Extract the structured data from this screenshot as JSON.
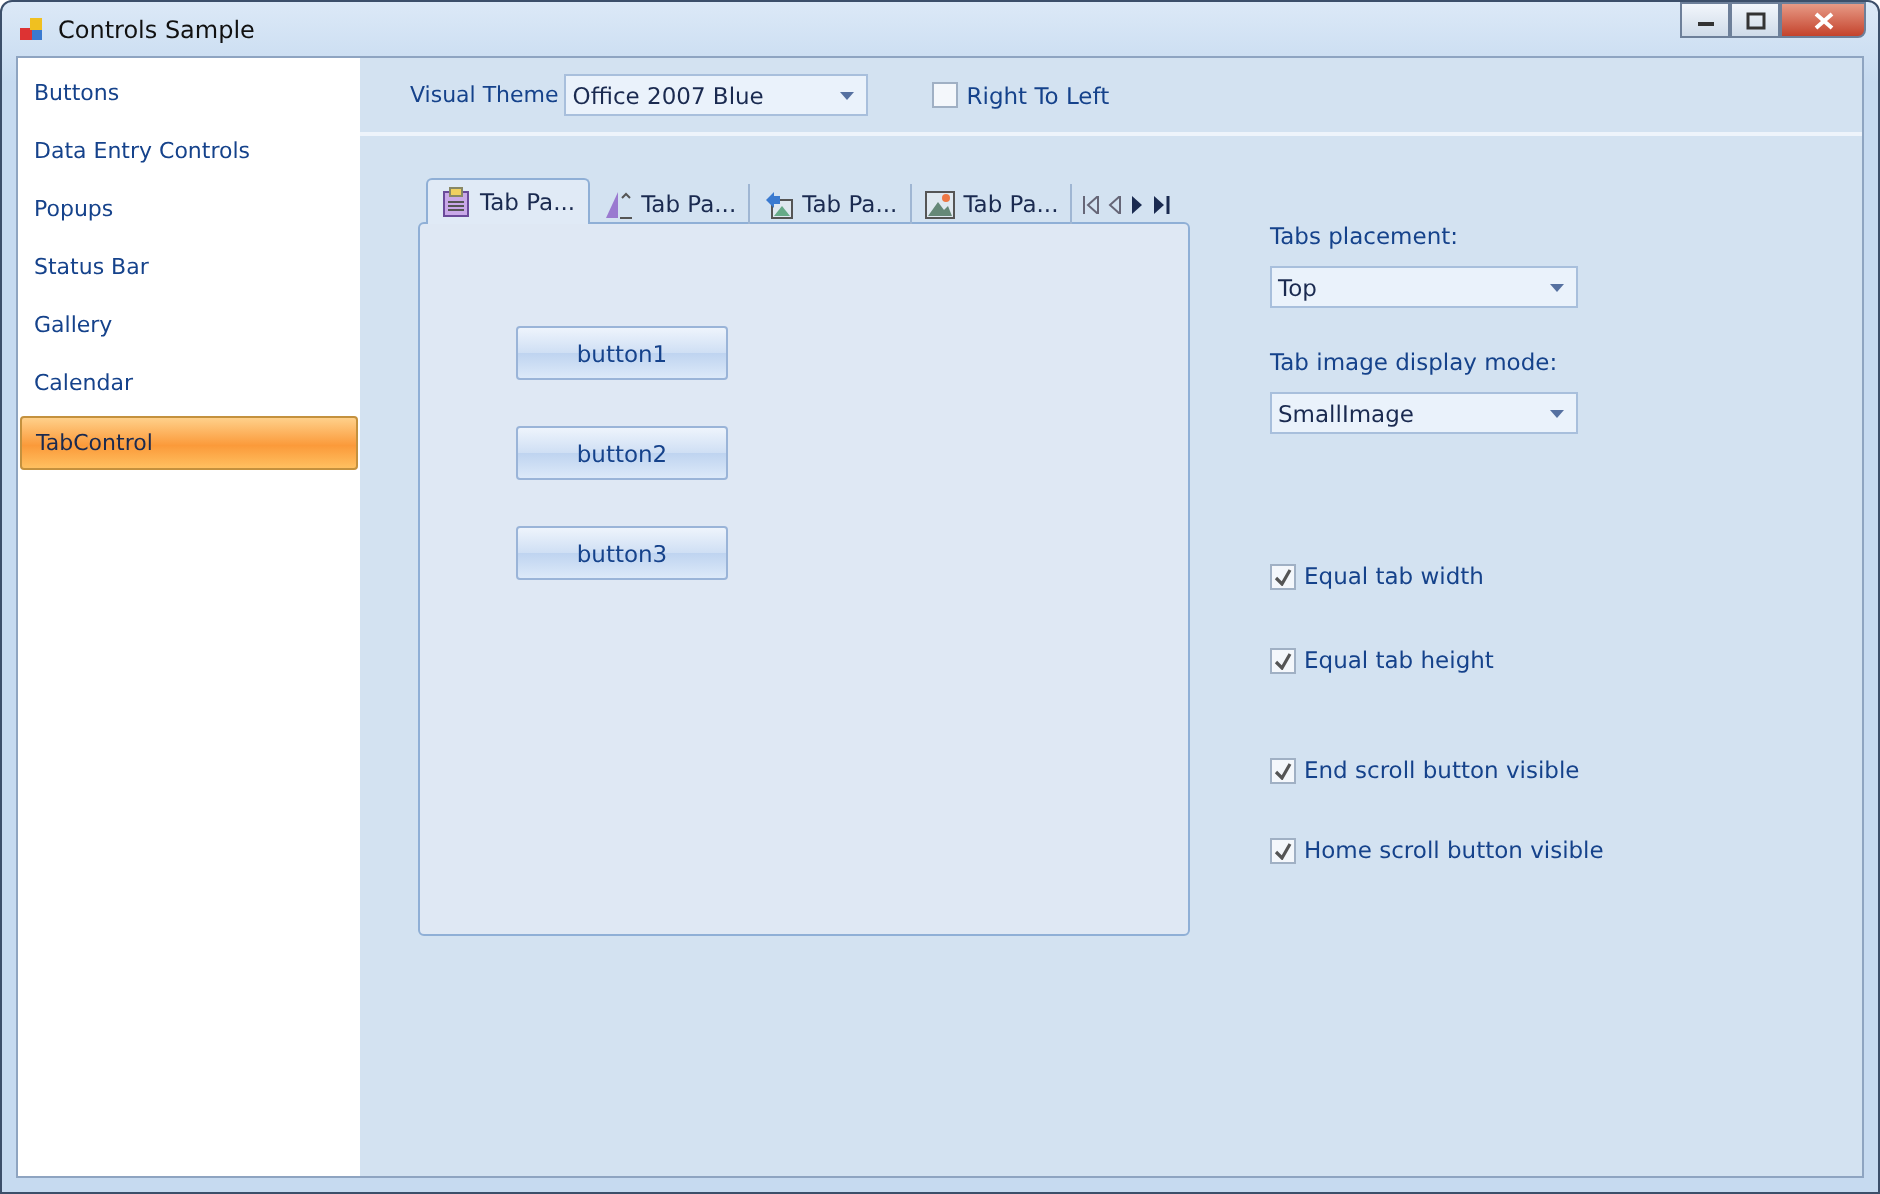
{
  "window": {
    "title": "Controls Sample"
  },
  "sidebar": {
    "items": [
      {
        "label": "Buttons",
        "selected": false
      },
      {
        "label": "Data Entry Controls",
        "selected": false
      },
      {
        "label": "Popups",
        "selected": false
      },
      {
        "label": "Status Bar",
        "selected": false
      },
      {
        "label": "Gallery",
        "selected": false
      },
      {
        "label": "Calendar",
        "selected": false
      },
      {
        "label": "TabControl",
        "selected": true
      }
    ]
  },
  "toolbar": {
    "theme_label": "Visual Theme",
    "theme_value": "Office 2007 Blue",
    "right_to_left": {
      "label": "Right To Left",
      "checked": false
    }
  },
  "tab_control": {
    "tabs": [
      {
        "label": "Tab Pa...",
        "selected": true
      },
      {
        "label": "Tab Pa...",
        "selected": false
      },
      {
        "label": "Tab Pa...",
        "selected": false
      },
      {
        "label": "Tab Pa...",
        "selected": false
      }
    ],
    "buttons": [
      "button1",
      "button2",
      "button3"
    ]
  },
  "settings": {
    "placement_label": "Tabs placement:",
    "placement_value": "Top",
    "image_mode_label": "Tab image display mode:",
    "image_mode_value": "SmallImage",
    "checkboxes": [
      {
        "label": "Equal tab width",
        "checked": true
      },
      {
        "label": "Equal tab height",
        "checked": true
      },
      {
        "label": "End scroll button visible",
        "checked": true
      },
      {
        "label": "Home scroll button visible",
        "checked": true
      }
    ]
  }
}
